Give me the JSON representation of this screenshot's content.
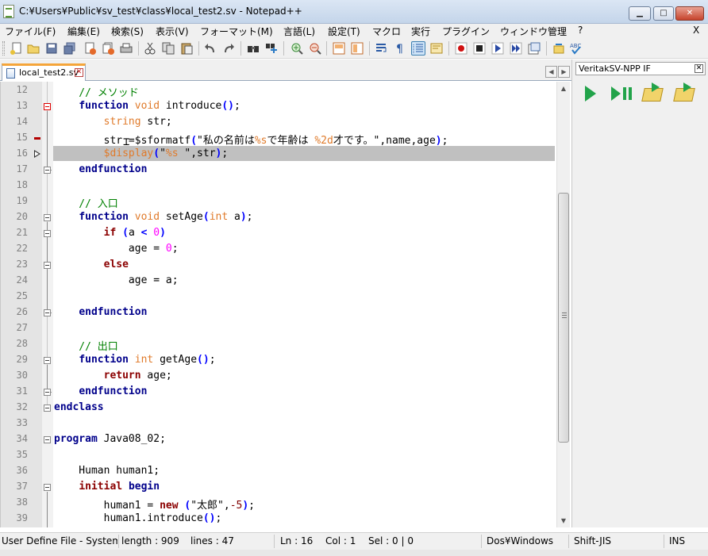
{
  "window": {
    "title": "C:¥Users¥Public¥sv_test¥class¥local_test2.sv - Notepad++",
    "minimize_label": "▁",
    "maximize_label": "□",
    "close_label": "✕"
  },
  "menu": {
    "items": [
      "ファイル(F)",
      "編集(E)",
      "検索(S)",
      "表示(V)",
      "フォーマット(M)",
      "言語(L)",
      "設定(T)",
      "マクロ",
      "実行",
      "プラグイン",
      "ウィンドウ管理",
      "?"
    ],
    "close_doc": "X"
  },
  "toolbar": {
    "icons": [
      "new-file-icon",
      "open-file-icon",
      "save-icon",
      "save-all-icon",
      "close-icon",
      "close-all-icon",
      "print-icon",
      "cut-icon",
      "copy-icon",
      "paste-icon",
      "undo-icon",
      "redo-icon",
      "find-icon",
      "replace-icon",
      "zoom-in-icon",
      "zoom-out-icon",
      "sync-vertical-icon",
      "sync-horizontal-icon",
      "word-wrap-icon",
      "show-all-chars-icon",
      "indent-guide-icon",
      "doc-map-icon",
      "record-macro-icon",
      "stop-macro-icon",
      "play-macro-icon",
      "run-macro-multiple-icon",
      "save-macro-icon",
      "spell-check-icon",
      "abc-check-icon"
    ]
  },
  "tab": {
    "label": "local_test2.sv",
    "close": "✕",
    "nav_left": "◀",
    "nav_right": "▶"
  },
  "editor": {
    "current_line": 16,
    "lines": [
      {
        "n": "12",
        "html": [
          [
            "cm",
            "    // メソッド"
          ]
        ]
      },
      {
        "n": "13",
        "html": [
          [
            "",
            "    "
          ],
          [
            "kw",
            "function"
          ],
          [
            "",
            " "
          ],
          [
            "ty",
            "void"
          ],
          [
            "",
            " introduce"
          ],
          [
            "op",
            "()"
          ],
          [
            "",
            ";"
          ]
        ]
      },
      {
        "n": "14",
        "html": [
          [
            "",
            "        "
          ],
          [
            "ty",
            "string"
          ],
          [
            "",
            " str;"
          ]
        ]
      },
      {
        "n": "15",
        "html": [
          [
            "",
            "        str =$sformatf"
          ],
          [
            "op",
            "("
          ],
          [
            "",
            "\"私の名前は"
          ],
          [
            "sys",
            "%s"
          ],
          [
            "",
            "で年齢は "
          ],
          [
            "sys",
            "%2d"
          ],
          [
            "",
            "才です。\",name,age"
          ],
          [
            "op",
            ")"
          ],
          [
            "",
            ";"
          ]
        ]
      },
      {
        "n": "16",
        "html": [
          [
            "",
            "        "
          ],
          [
            "sys",
            "$display"
          ],
          [
            "op",
            "("
          ],
          [
            "",
            "\""
          ],
          [
            "sys",
            "%s"
          ],
          [
            "",
            " \",str"
          ],
          [
            "op",
            ")"
          ],
          [
            "",
            ";"
          ]
        ]
      },
      {
        "n": "17",
        "html": [
          [
            "",
            "    "
          ],
          [
            "kw",
            "endfunction"
          ]
        ]
      },
      {
        "n": "18",
        "html": [
          [
            "",
            ""
          ]
        ]
      },
      {
        "n": "19",
        "html": [
          [
            "cm",
            "    // 入口"
          ]
        ]
      },
      {
        "n": "20",
        "html": [
          [
            "",
            "    "
          ],
          [
            "kw",
            "function"
          ],
          [
            "",
            " "
          ],
          [
            "ty",
            "void"
          ],
          [
            "",
            " setAge"
          ],
          [
            "op",
            "("
          ],
          [
            "ty",
            "int"
          ],
          [
            "",
            " a"
          ],
          [
            "op",
            ")"
          ],
          [
            "",
            ";"
          ]
        ]
      },
      {
        "n": "21",
        "html": [
          [
            "",
            "        "
          ],
          [
            "kw2",
            "if"
          ],
          [
            "",
            " "
          ],
          [
            "op",
            "("
          ],
          [
            "",
            "a "
          ],
          [
            "op",
            "<"
          ],
          [
            "",
            " "
          ],
          [
            "num",
            "0"
          ],
          [
            "op",
            ")"
          ]
        ]
      },
      {
        "n": "22",
        "html": [
          [
            "",
            "            age = "
          ],
          [
            "num",
            "0"
          ],
          [
            "",
            ";"
          ]
        ]
      },
      {
        "n": "23",
        "html": [
          [
            "",
            "        "
          ],
          [
            "kw2",
            "else"
          ]
        ]
      },
      {
        "n": "24",
        "html": [
          [
            "",
            "            age = a;"
          ]
        ]
      },
      {
        "n": "25",
        "html": [
          [
            "",
            ""
          ]
        ]
      },
      {
        "n": "26",
        "html": [
          [
            "",
            "    "
          ],
          [
            "kw",
            "endfunction"
          ]
        ]
      },
      {
        "n": "27",
        "html": [
          [
            "",
            ""
          ]
        ]
      },
      {
        "n": "28",
        "html": [
          [
            "cm",
            "    // 出口"
          ]
        ]
      },
      {
        "n": "29",
        "html": [
          [
            "",
            "    "
          ],
          [
            "kw",
            "function"
          ],
          [
            "",
            " "
          ],
          [
            "ty",
            "int"
          ],
          [
            "",
            " getAge"
          ],
          [
            "op",
            "()"
          ],
          [
            "",
            ";"
          ]
        ]
      },
      {
        "n": "30",
        "html": [
          [
            "",
            "        "
          ],
          [
            "kw2",
            "return"
          ],
          [
            "",
            " age;"
          ]
        ]
      },
      {
        "n": "31",
        "html": [
          [
            "",
            "    "
          ],
          [
            "kw",
            "endfunction"
          ]
        ]
      },
      {
        "n": "32",
        "html": [
          [
            "kw",
            "endclass"
          ]
        ]
      },
      {
        "n": "33",
        "html": [
          [
            "",
            ""
          ]
        ]
      },
      {
        "n": "34",
        "html": [
          [
            "kw",
            "program"
          ],
          [
            "",
            " Java08_02;"
          ]
        ]
      },
      {
        "n": "35",
        "html": [
          [
            "",
            ""
          ]
        ]
      },
      {
        "n": "36",
        "html": [
          [
            "",
            "    Human human1;"
          ]
        ]
      },
      {
        "n": "37",
        "html": [
          [
            "",
            "    "
          ],
          [
            "kw2",
            "initial"
          ],
          [
            "",
            " "
          ],
          [
            "kw",
            "begin"
          ]
        ]
      },
      {
        "n": "38",
        "html": [
          [
            "",
            "        human1 = "
          ],
          [
            "kw2",
            "new"
          ],
          [
            "",
            " "
          ],
          [
            "op",
            "("
          ],
          [
            "",
            "\"太郎\","
          ],
          [
            "neg",
            "-5"
          ],
          [
            "op",
            ")"
          ],
          [
            "",
            ";"
          ]
        ]
      },
      {
        "n": "39",
        "html": [
          [
            "",
            "        human1.introduce"
          ],
          [
            "op",
            "()"
          ],
          [
            "",
            ";"
          ]
        ]
      }
    ]
  },
  "scrollbar": {
    "up_arrow": "▲",
    "down_arrow": "▼"
  },
  "panel": {
    "title": "VeritakSV-NPP IF",
    "close": "✕",
    "buttons": [
      "run-icon",
      "step-run-icon",
      "open-folder-icon",
      "folder-run-icon"
    ]
  },
  "status": {
    "file_type": "User Define File - System",
    "length": "length : 909",
    "lines": "lines : 47",
    "ln": "Ln : 16",
    "col": "Col : 1",
    "sel": "Sel : 0 | 0",
    "eol": "Dos¥Windows",
    "encoding": "Shift-JIS",
    "mode": "INS"
  }
}
